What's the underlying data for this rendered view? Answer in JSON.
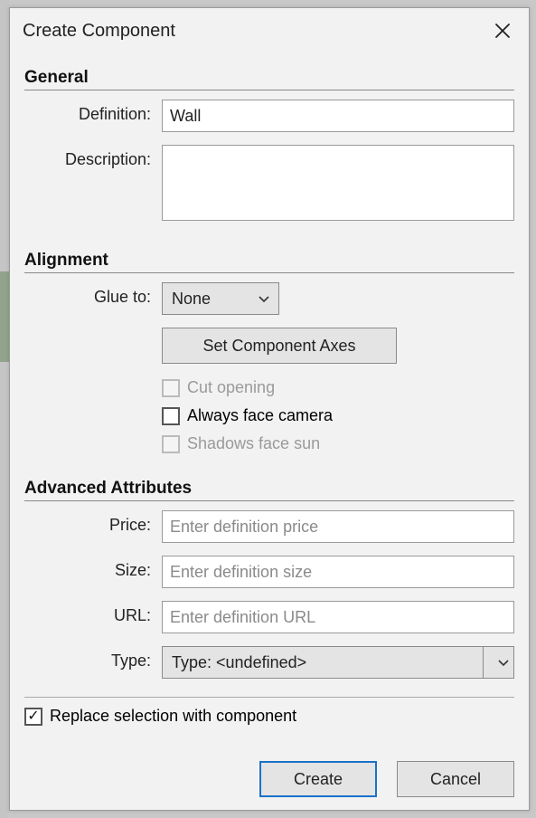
{
  "window": {
    "title": "Create Component"
  },
  "sections": {
    "general": {
      "heading": "General",
      "definition_label": "Definition:",
      "definition_value": "Wall",
      "description_label": "Description:",
      "description_value": ""
    },
    "alignment": {
      "heading": "Alignment",
      "glue_to_label": "Glue to:",
      "glue_to_value": "None",
      "set_axes_button": "Set Component Axes",
      "cut_opening_label": "Cut opening",
      "always_face_camera_label": "Always face camera",
      "shadows_face_sun_label": "Shadows face sun"
    },
    "advanced": {
      "heading": "Advanced Attributes",
      "price_label": "Price:",
      "price_placeholder": "Enter definition price",
      "size_label": "Size:",
      "size_placeholder": "Enter definition size",
      "url_label": "URL:",
      "url_placeholder": "Enter definition URL",
      "type_label": "Type:",
      "type_value": "Type: <undefined>"
    }
  },
  "replace_selection_label": "Replace selection with component",
  "buttons": {
    "create": "Create",
    "cancel": "Cancel"
  },
  "checkmark": "✓"
}
